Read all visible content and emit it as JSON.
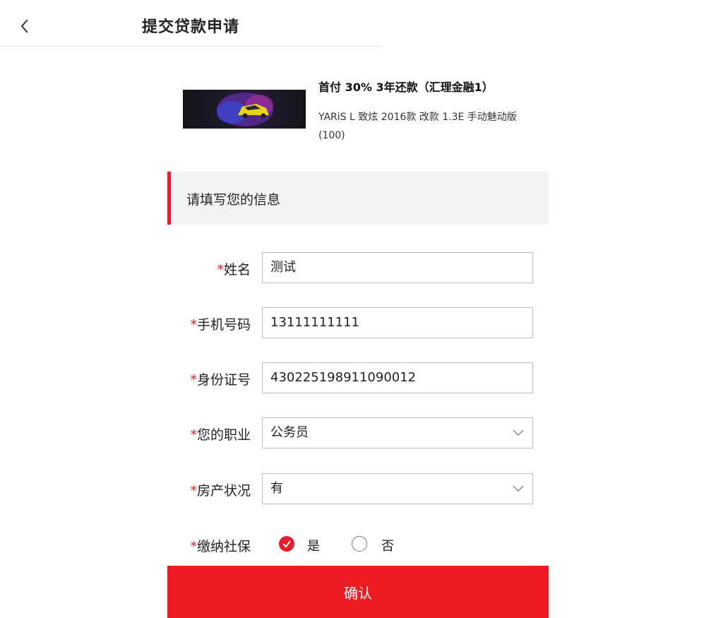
{
  "header": {
    "title": "提交贷款申请"
  },
  "product": {
    "title": "首付 30% 3年还款（汇理金融1）",
    "description": "YARiS L 致炫 2016款 改款 1.3E 手动魅动版 (100)"
  },
  "section": {
    "title": "请填写您的信息"
  },
  "form": {
    "required_mark": "*",
    "name": {
      "label": "姓名",
      "value": "测试"
    },
    "phone": {
      "label": "手机号码",
      "value": "13111111111"
    },
    "id_number": {
      "label": "身份证号",
      "value": "430225198911090012"
    },
    "occupation": {
      "label": "您的职业",
      "value": "公务员"
    },
    "property": {
      "label": "房产状况",
      "value": "有"
    },
    "social_security": {
      "label": "缴纳社保",
      "options": [
        {
          "label": "是",
          "checked": true
        },
        {
          "label": "否",
          "checked": false
        }
      ]
    }
  },
  "confirm_label": "确认",
  "colors": {
    "accent": "#ea1b2a",
    "button": "#ef1b23",
    "section_bg": "#f3f3f3"
  },
  "icons": {
    "back": "chevron-left-icon",
    "select": "chevron-down-icon",
    "check": "check-icon"
  }
}
